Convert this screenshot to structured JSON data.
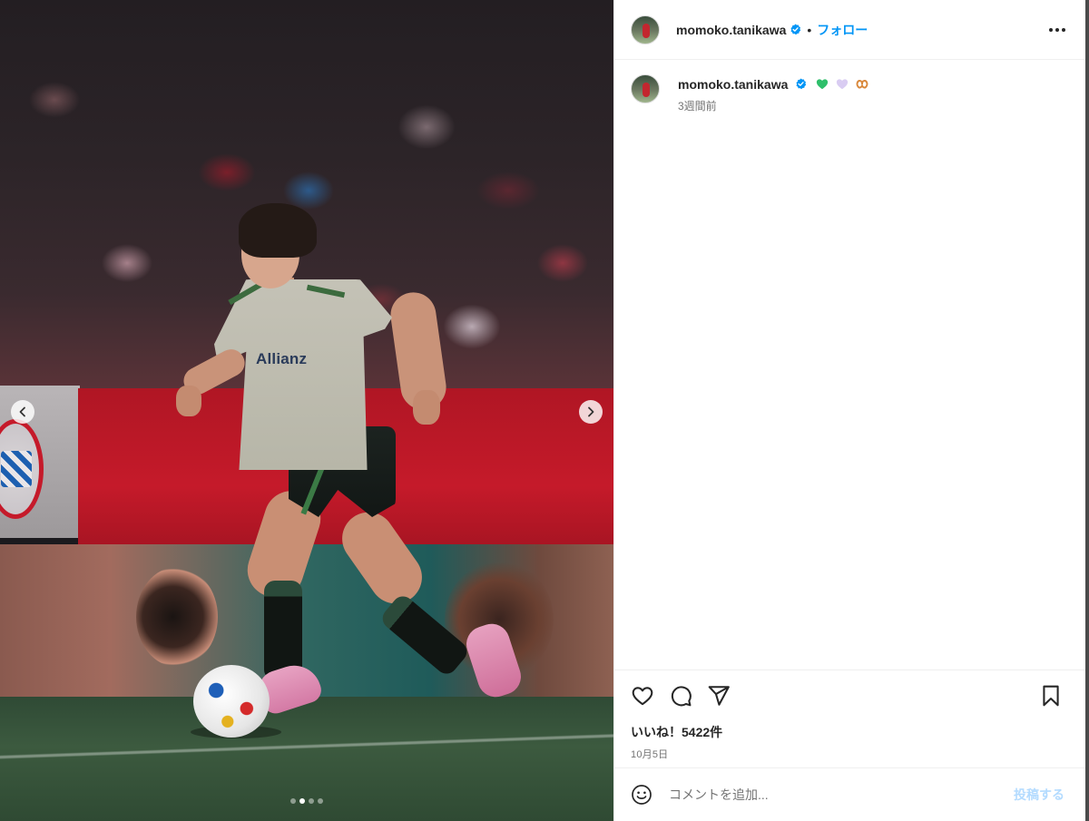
{
  "post": {
    "username": "momoko.tanikawa",
    "follow_label": "フォロー",
    "separator": "•",
    "caption_username": "momoko.tanikawa",
    "caption_emojis": [
      "green-heart",
      "light-purple-heart",
      "pretzel"
    ],
    "time_ago": "3週間前",
    "likes": "いいね！5422件",
    "date": "10月5日"
  },
  "media": {
    "jersey_sponsor": "Allianz",
    "carousel_count": 4,
    "carousel_active_index": 1
  },
  "comment": {
    "placeholder": "コメントを追加...",
    "post_label": "投稿する"
  },
  "colors": {
    "accent": "#0095f6",
    "post_disabled": "#b3dbff",
    "verified": "#0095f6"
  },
  "icons": {
    "header": [
      "verified-badge-icon",
      "more-options-icon"
    ],
    "actions": [
      "heart-icon",
      "comment-icon",
      "share-icon",
      "bookmark-icon"
    ],
    "comment_bar": [
      "emoji-icon"
    ],
    "media": [
      "chevron-left-icon",
      "chevron-right-icon"
    ]
  }
}
